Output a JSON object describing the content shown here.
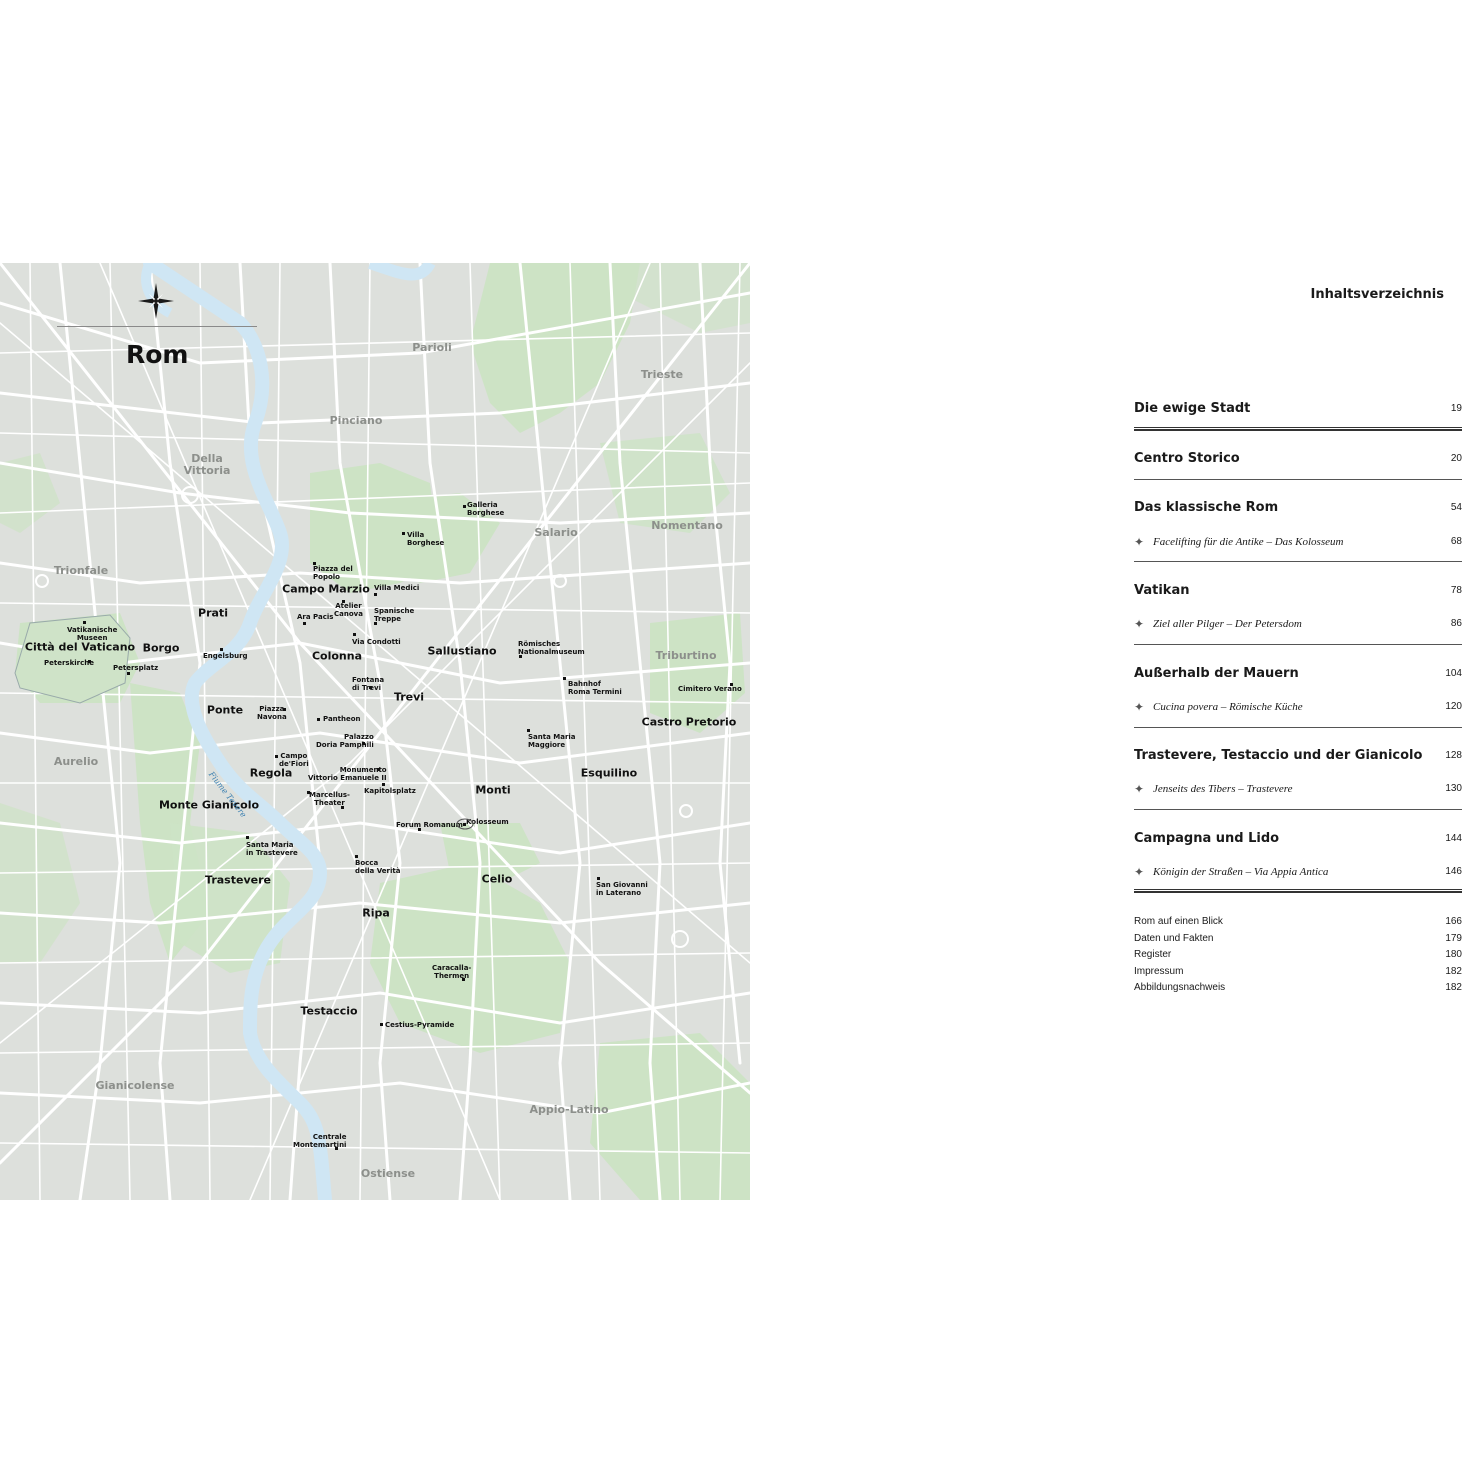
{
  "map": {
    "title": "Rom",
    "river_label": "Fiume Tevere",
    "districts": [
      {
        "name": "Parioli"
      },
      {
        "name": "Trieste"
      },
      {
        "name": "Pinciano"
      },
      {
        "name": "Della\nVittoria"
      },
      {
        "name": "Salario"
      },
      {
        "name": "Nomentano"
      },
      {
        "name": "Trionfale"
      },
      {
        "name": "Triburtino"
      },
      {
        "name": "Aurelio"
      },
      {
        "name": "Gianicolense"
      },
      {
        "name": "Appio-Latino"
      },
      {
        "name": "Ostiense"
      }
    ],
    "quarters": [
      {
        "name": "Campo Marzio"
      },
      {
        "name": "Prati"
      },
      {
        "name": "Città del Vaticano"
      },
      {
        "name": "Borgo"
      },
      {
        "name": "Colonna"
      },
      {
        "name": "Sallustiano"
      },
      {
        "name": "Trevi"
      },
      {
        "name": "Ponte"
      },
      {
        "name": "Castro Pretorio"
      },
      {
        "name": "Regola"
      },
      {
        "name": "Esquilino"
      },
      {
        "name": "Monti"
      },
      {
        "name": "Monte Gianicolo"
      },
      {
        "name": "Trastevere"
      },
      {
        "name": "Celio"
      },
      {
        "name": "Ripa"
      },
      {
        "name": "Testaccio"
      }
    ],
    "pois": [
      {
        "name": "Galleria\nBorghese"
      },
      {
        "name": "Villa\nBorghese"
      },
      {
        "name": "Piazza del\nPopolo"
      },
      {
        "name": "Villa Medici"
      },
      {
        "name": "Atelier\nCanova"
      },
      {
        "name": "Spanische\nTreppe"
      },
      {
        "name": "Ara Pacis"
      },
      {
        "name": "Via Condotti"
      },
      {
        "name": "Vatikanische\nMuseen"
      },
      {
        "name": "Peterskirche"
      },
      {
        "name": "Petersplatz"
      },
      {
        "name": "Engelsburg"
      },
      {
        "name": "Römisches\nNationalmuseum"
      },
      {
        "name": "Fontana\ndi Trevi"
      },
      {
        "name": "Bahnhof\nRoma Termini"
      },
      {
        "name": "Cimitero Verano"
      },
      {
        "name": "Piazza\nNavona"
      },
      {
        "name": "Pantheon"
      },
      {
        "name": "Palazzo\nDoria Pamphili"
      },
      {
        "name": "Santa Maria\nMaggiore"
      },
      {
        "name": "Campo\nde'Fiori"
      },
      {
        "name": "Monumento\nVittorio Emanuele II"
      },
      {
        "name": "Marcellus-\nTheater"
      },
      {
        "name": "Kapitolsplatz"
      },
      {
        "name": "Forum Romanum"
      },
      {
        "name": "Kolosseum"
      },
      {
        "name": "Santa Maria\nin Trastevere"
      },
      {
        "name": "Bocca\ndella Verità"
      },
      {
        "name": "San Giovanni\nin Laterano"
      },
      {
        "name": "Caracalla-\nThermen"
      },
      {
        "name": "Cestius-Pyramide"
      },
      {
        "name": "Centrale\nMontemartini"
      }
    ]
  },
  "toc": {
    "heading": "Inhaltsverzeichnis",
    "chapters": [
      {
        "title": "Die ewige Stadt",
        "page": "19",
        "subs": []
      },
      {
        "title": "Centro Storico",
        "page": "20",
        "subs": []
      },
      {
        "title": "Das klassische Rom",
        "page": "54",
        "subs": [
          {
            "title": "Facelifting für die Antike – Das Kolosseum",
            "page": "68"
          }
        ]
      },
      {
        "title": "Vatikan",
        "page": "78",
        "subs": [
          {
            "title": "Ziel aller Pilger – Der Petersdom",
            "page": "86"
          }
        ]
      },
      {
        "title": "Außerhalb der Mauern",
        "page": "104",
        "subs": [
          {
            "title": "Cucina povera – Römische Küche",
            "page": "120"
          }
        ]
      },
      {
        "title": "Trastevere, Testaccio und der Gianicolo",
        "page": "128",
        "subs": [
          {
            "title": "Jenseits des Tibers – Trastevere",
            "page": "130"
          }
        ]
      },
      {
        "title": "Campagna und Lido",
        "page": "144",
        "subs": [
          {
            "title": "Königin der Straßen – Via Appia Antica",
            "page": "146"
          }
        ]
      }
    ],
    "appendix": [
      {
        "title": "Rom auf einen Blick",
        "page": "166"
      },
      {
        "title": "Daten und Fakten",
        "page": "179"
      },
      {
        "title": "Register",
        "page": "180"
      },
      {
        "title": "Impressum",
        "page": "182"
      },
      {
        "title": "Abbildungsnachweis",
        "page": "182"
      }
    ]
  },
  "colors": {
    "land": "#dde0dc",
    "park": "#cde3c5",
    "road": "#ffffff",
    "river": "#cfe6f4"
  }
}
